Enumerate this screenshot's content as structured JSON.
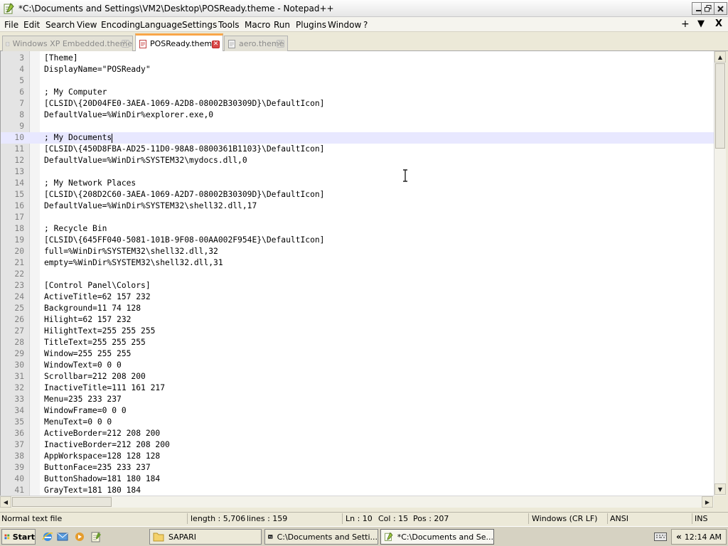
{
  "window": {
    "title": "*C:\\Documents and Settings\\VM2\\Desktop\\POSReady.theme - Notepad++",
    "controls": [
      "minimize",
      "restore",
      "close"
    ]
  },
  "menu": {
    "items": [
      "File",
      "Edit",
      "Search",
      "View",
      "Encoding",
      "Language",
      "Settings",
      "Tools",
      "Macro",
      "Run",
      "Plugins",
      "Window",
      "?"
    ],
    "right": [
      "+",
      "▼",
      "X"
    ]
  },
  "tabs": [
    {
      "label": "Windows XP Embedded.theme",
      "active": false
    },
    {
      "label": "POSReady.theme",
      "active": true
    },
    {
      "label": "aero.theme",
      "active": false
    }
  ],
  "editor": {
    "current_line": 10,
    "lines": [
      {
        "n": "3",
        "text": "[Theme]"
      },
      {
        "n": "4",
        "text": "DisplayName=\"POSReady\""
      },
      {
        "n": "5",
        "text": ""
      },
      {
        "n": "6",
        "text": "; My Computer"
      },
      {
        "n": "7",
        "text": "[CLSID\\{20D04FE0-3AEA-1069-A2D8-08002B30309D}\\DefaultIcon]"
      },
      {
        "n": "8",
        "text": "DefaultValue=%WinDir%explorer.exe,0"
      },
      {
        "n": "9",
        "text": ""
      },
      {
        "n": "10",
        "text": "; My Documents"
      },
      {
        "n": "11",
        "text": "[CLSID\\{450D8FBA-AD25-11D0-98A8-0800361B1103}\\DefaultIcon]"
      },
      {
        "n": "12",
        "text": "DefaultValue=%WinDir%SYSTEM32\\mydocs.dll,0"
      },
      {
        "n": "13",
        "text": ""
      },
      {
        "n": "14",
        "text": "; My Network Places"
      },
      {
        "n": "15",
        "text": "[CLSID\\{208D2C60-3AEA-1069-A2D7-08002B30309D}\\DefaultIcon]"
      },
      {
        "n": "16",
        "text": "DefaultValue=%WinDir%SYSTEM32\\shell32.dll,17"
      },
      {
        "n": "17",
        "text": ""
      },
      {
        "n": "18",
        "text": "; Recycle Bin"
      },
      {
        "n": "19",
        "text": "[CLSID\\{645FF040-5081-101B-9F08-00AA002F954E}\\DefaultIcon]"
      },
      {
        "n": "20",
        "text": "full=%WinDir%SYSTEM32\\shell32.dll,32"
      },
      {
        "n": "21",
        "text": "empty=%WinDir%SYSTEM32\\shell32.dll,31"
      },
      {
        "n": "22",
        "text": ""
      },
      {
        "n": "23",
        "text": "[Control Panel\\Colors]"
      },
      {
        "n": "24",
        "text": "ActiveTitle=62 157 232"
      },
      {
        "n": "25",
        "text": "Background=11 74 128"
      },
      {
        "n": "26",
        "text": "Hilight=62 157 232"
      },
      {
        "n": "27",
        "text": "HilightText=255 255 255"
      },
      {
        "n": "28",
        "text": "TitleText=255 255 255"
      },
      {
        "n": "29",
        "text": "Window=255 255 255"
      },
      {
        "n": "30",
        "text": "WindowText=0 0 0"
      },
      {
        "n": "31",
        "text": "Scrollbar=212 208 200"
      },
      {
        "n": "32",
        "text": "InactiveTitle=111 161 217"
      },
      {
        "n": "33",
        "text": "Menu=235 233 237"
      },
      {
        "n": "34",
        "text": "WindowFrame=0 0 0"
      },
      {
        "n": "35",
        "text": "MenuText=0 0 0"
      },
      {
        "n": "36",
        "text": "ActiveBorder=212 208 200"
      },
      {
        "n": "37",
        "text": "InactiveBorder=212 208 200"
      },
      {
        "n": "38",
        "text": "AppWorkspace=128 128 128"
      },
      {
        "n": "39",
        "text": "ButtonFace=235 233 237"
      },
      {
        "n": "40",
        "text": "ButtonShadow=181 180 184"
      },
      {
        "n": "41",
        "text": "GrayText=181 180 184"
      }
    ]
  },
  "status": {
    "type": "Normal text file",
    "length": "length : 5,706",
    "lines": "lines : 159",
    "ln": "Ln : 10",
    "col": "Col : 15",
    "pos": "Pos : 207",
    "eol": "Windows (CR LF)",
    "encoding": "ANSI",
    "mode": "INS"
  },
  "taskbar": {
    "start_label": "Start",
    "buttons": [
      {
        "label": "SAPARI",
        "icon": "folder-icon",
        "active": false
      },
      {
        "label": "C:\\Documents and Setti...",
        "icon": "7zip-icon",
        "active": false
      },
      {
        "label": "*C:\\Documents and Se...",
        "icon": "notepadpp-icon",
        "active": true
      }
    ],
    "clock": "12:14 AM"
  },
  "colors": {
    "active_tab_accent": "#f9a648",
    "tab_close": "#d94848",
    "current_line": "#e8e8ff"
  }
}
